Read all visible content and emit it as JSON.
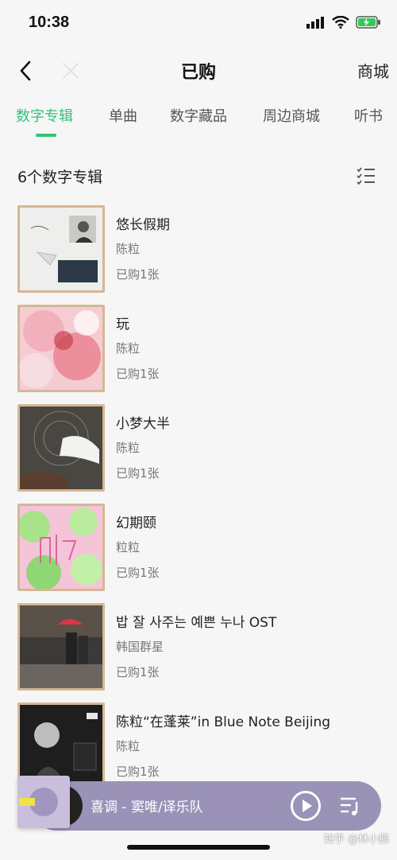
{
  "status": {
    "time": "10:38"
  },
  "nav": {
    "title": "已购",
    "right": "商城"
  },
  "tabs": [
    {
      "label": "数字专辑",
      "active": true
    },
    {
      "label": "单曲",
      "active": false
    },
    {
      "label": "数字藏品",
      "active": false
    },
    {
      "label": "周边商城",
      "active": false
    },
    {
      "label": "听书",
      "active": false
    }
  ],
  "section": {
    "title": "6个数字专辑"
  },
  "albums": [
    {
      "title": "悠长假期",
      "artist": "陈粒",
      "count": "已购1张"
    },
    {
      "title": "玩",
      "artist": "陈粒",
      "count": "已购1张"
    },
    {
      "title": "小梦大半",
      "artist": "陈粒",
      "count": "已购1张"
    },
    {
      "title": "幻期颐",
      "artist": "粒粒",
      "count": "已购1张"
    },
    {
      "title": "밥 잘 사주는 예쁜 누나 OST",
      "artist": "韩国群星",
      "count": "已购1张"
    },
    {
      "title": "陈粒“在蓬莱”in Blue Note Beijing",
      "artist": "陈粒",
      "count": "已购1张"
    }
  ],
  "player": {
    "now_playing": "喜调 - 窦唯/译乐队"
  },
  "watermark": "知乎 @林小鹅",
  "colors": {
    "accent": "#31c27c",
    "player_bg": "#9b92b8",
    "cover_border": "#d4b896"
  },
  "icons": [
    "back-icon",
    "close-icon",
    "list-mode-icon",
    "play-icon",
    "playlist-icon",
    "signal-icon",
    "wifi-icon",
    "battery-icon"
  ]
}
